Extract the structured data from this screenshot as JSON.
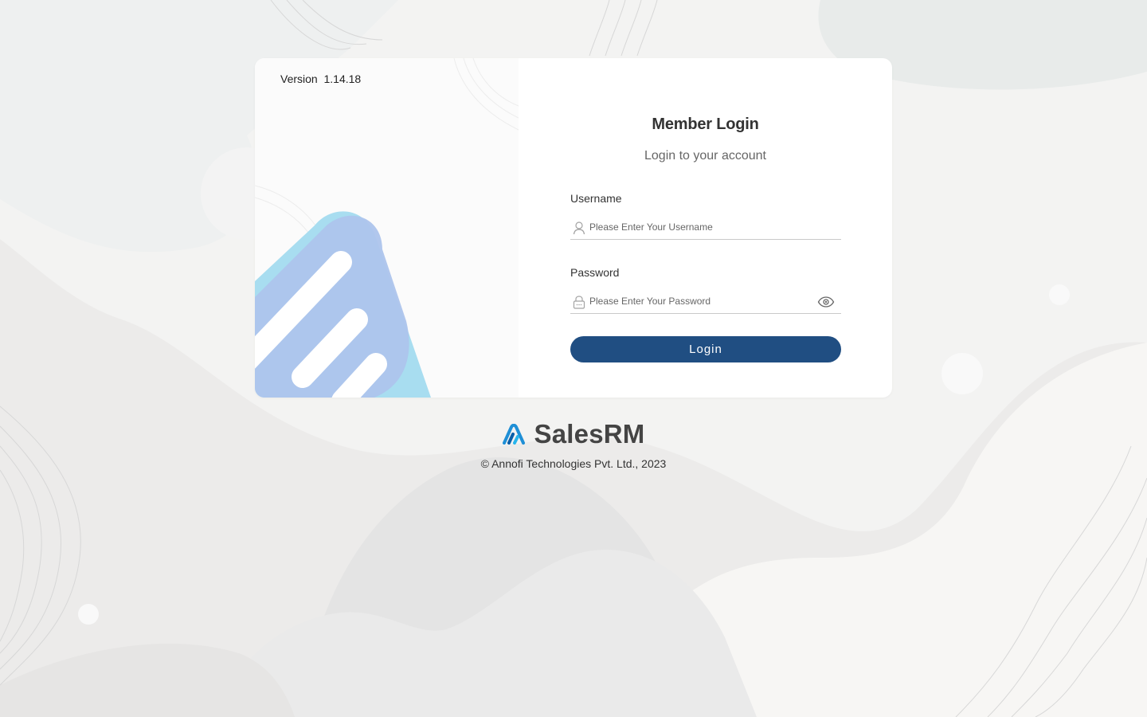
{
  "version": {
    "label": "Version",
    "value": "1.14.18"
  },
  "login": {
    "title": "Member Login",
    "subtitle": "Login to your account",
    "username_label": "Username",
    "username_placeholder": "Please Enter Your Username",
    "username_value": "",
    "password_label": "Password",
    "password_placeholder": "Please Enter Your Password",
    "password_value": "",
    "button_label": "Login"
  },
  "brand": {
    "name": "SalesRM",
    "logo_icon": "salesrm-logo-icon"
  },
  "footer": {
    "copyright": "© Annofi Technologies Pvt. Ltd., 2023"
  },
  "icons": {
    "username": "user-icon",
    "password": "lock-icon",
    "toggle": "eye-icon"
  },
  "colors": {
    "primary": "#204e82",
    "accent_light_blue": "#a8ddf0",
    "accent_periwinkle": "#adc4ec",
    "background": "#ecebea"
  }
}
